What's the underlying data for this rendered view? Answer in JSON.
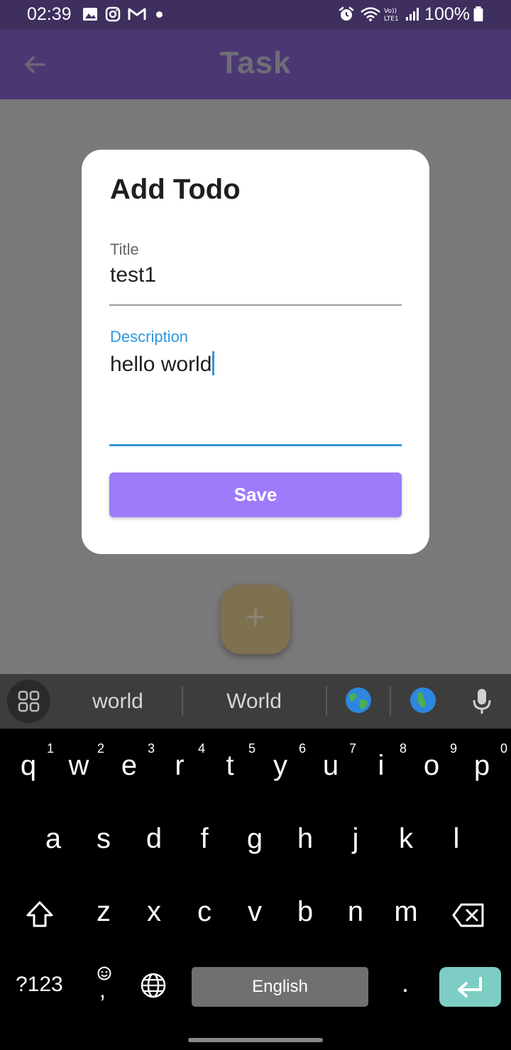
{
  "status_bar": {
    "time": "02:39",
    "battery": "100%"
  },
  "app_bar": {
    "title": "Task"
  },
  "dialog": {
    "heading": "Add Todo",
    "title_field": {
      "label": "Title",
      "value": "test1"
    },
    "description_field": {
      "label": "Description",
      "value": "hello world"
    },
    "save_label": "Save"
  },
  "fab": {
    "symbol": "+"
  },
  "suggestions": {
    "items": [
      "world",
      "World"
    ]
  },
  "keyboard": {
    "row1": [
      {
        "k": "q",
        "h": "1"
      },
      {
        "k": "w",
        "h": "2"
      },
      {
        "k": "e",
        "h": "3"
      },
      {
        "k": "r",
        "h": "4"
      },
      {
        "k": "t",
        "h": "5"
      },
      {
        "k": "y",
        "h": "6"
      },
      {
        "k": "u",
        "h": "7"
      },
      {
        "k": "i",
        "h": "8"
      },
      {
        "k": "o",
        "h": "9"
      },
      {
        "k": "p",
        "h": "0"
      }
    ],
    "row2": [
      "a",
      "s",
      "d",
      "f",
      "g",
      "h",
      "j",
      "k",
      "l"
    ],
    "row3": [
      "z",
      "x",
      "c",
      "v",
      "b",
      "n",
      "m"
    ],
    "symbols_label": "?123",
    "comma_label": ",",
    "space_label": "English",
    "period_label": "."
  },
  "colors": {
    "accent": "#2f97db",
    "save_button": "#9d7bfb",
    "app_bar": "#4b3873",
    "enter_key": "#7ecdc4"
  }
}
